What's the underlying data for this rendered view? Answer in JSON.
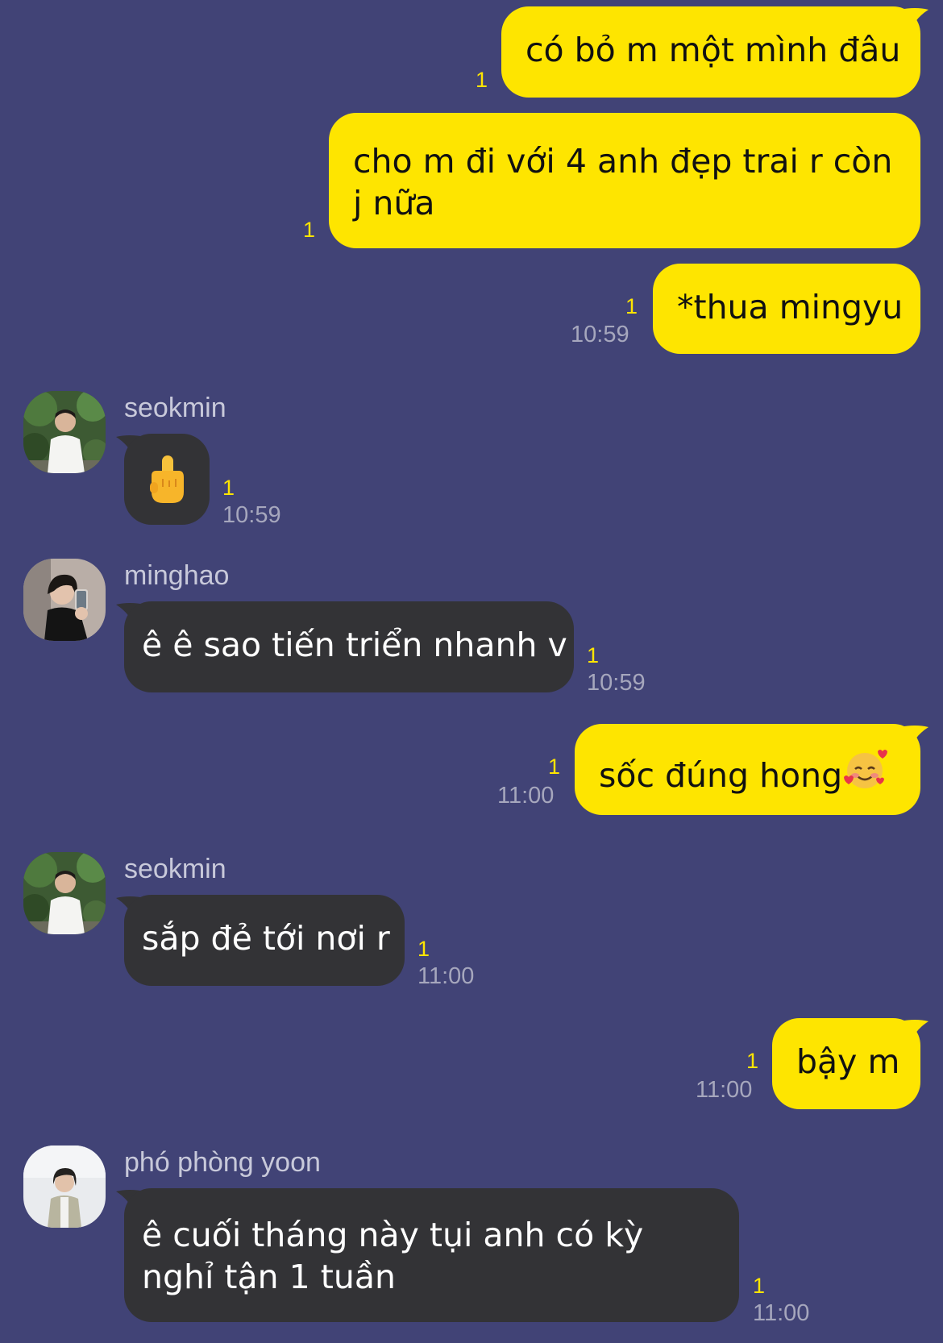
{
  "colors": {
    "background": "#414376",
    "outgoing_bubble": "#fee500",
    "incoming_bubble": "#333336",
    "unread_count": "#fee500",
    "timestamp": "#a6a7bd",
    "sender_name": "#c8c9da"
  },
  "messages": [
    {
      "id": "m1",
      "direction": "out",
      "text": "có bỏ m một mình đâu",
      "unread": "1",
      "time": ""
    },
    {
      "id": "m2",
      "direction": "out",
      "text": "cho m đi với 4 anh đẹp trai r còn j nữa",
      "unread": "1",
      "time": ""
    },
    {
      "id": "m3",
      "direction": "out",
      "text": "*thua mingyu",
      "unread": "1",
      "time": "10:59"
    },
    {
      "id": "m4",
      "direction": "in",
      "sender": "seokmin",
      "avatar": "seokmin-avatar",
      "text": "🖕",
      "emoji_icon": "middle-finger-emoji-icon",
      "unread": "1",
      "time": "10:59"
    },
    {
      "id": "m5",
      "direction": "in",
      "sender": "minghao",
      "avatar": "minghao-avatar",
      "text": "ê ê sao tiến triển nhanh v",
      "unread": "1",
      "time": "10:59"
    },
    {
      "id": "m6",
      "direction": "out",
      "text": "sốc đúng hong",
      "emoji_icon": "smiling-face-with-hearts-emoji-icon",
      "unread": "1",
      "time": "11:00"
    },
    {
      "id": "m7",
      "direction": "in",
      "sender": "seokmin",
      "avatar": "seokmin-avatar",
      "text": "sắp đẻ tới nơi r",
      "unread": "1",
      "time": "11:00"
    },
    {
      "id": "m8",
      "direction": "out",
      "text": "bậy m",
      "unread": "1",
      "time": "11:00"
    },
    {
      "id": "m9",
      "direction": "in",
      "sender": "phó phòng yoon",
      "avatar": "yoon-avatar",
      "text": "ê cuối tháng này tụi anh có kỳ nghỉ tận 1 tuần",
      "unread": "1",
      "time": "11:00"
    }
  ]
}
